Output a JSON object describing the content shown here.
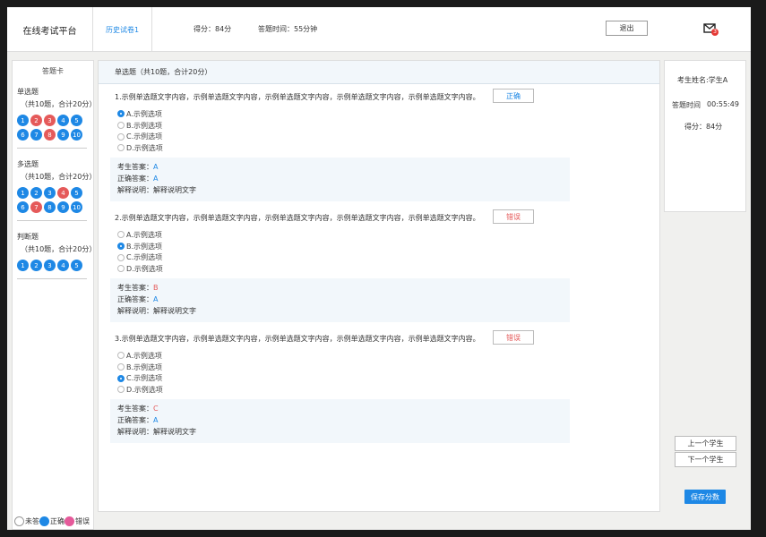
{
  "header": {
    "app_title": "在线考试平台",
    "history_tab": "历史试卷1",
    "score": "得分：84分",
    "answer_time": "答题时间：55分钟",
    "exit_label": "退出",
    "mail_badge": "3"
  },
  "sidebar": {
    "card_title": "答题卡",
    "sections": [
      {
        "title": "单选题",
        "subtitle": "（共10题，合计20分）",
        "items": [
          {
            "n": "1",
            "status": "correct"
          },
          {
            "n": "2",
            "status": "wrong"
          },
          {
            "n": "3",
            "status": "wrong"
          },
          {
            "n": "4",
            "status": "correct"
          },
          {
            "n": "5",
            "status": "correct"
          },
          {
            "n": "6",
            "status": "correct"
          },
          {
            "n": "7",
            "status": "correct"
          },
          {
            "n": "8",
            "status": "wrong"
          },
          {
            "n": "9",
            "status": "correct"
          },
          {
            "n": "10",
            "status": "correct"
          }
        ]
      },
      {
        "title": "多选题",
        "subtitle": "（共10题，合计20分）",
        "items": [
          {
            "n": "1",
            "status": "correct"
          },
          {
            "n": "2",
            "status": "correct"
          },
          {
            "n": "3",
            "status": "correct"
          },
          {
            "n": "4",
            "status": "wrong"
          },
          {
            "n": "5",
            "status": "correct"
          },
          {
            "n": "6",
            "status": "correct"
          },
          {
            "n": "7",
            "status": "wrong"
          },
          {
            "n": "8",
            "status": "correct"
          },
          {
            "n": "9",
            "status": "correct"
          },
          {
            "n": "10",
            "status": "correct"
          }
        ]
      },
      {
        "title": "判断题",
        "subtitle": "（共10题，合计20分）",
        "items": [
          {
            "n": "1",
            "status": "correct"
          },
          {
            "n": "2",
            "status": "correct"
          },
          {
            "n": "3",
            "status": "correct"
          },
          {
            "n": "4",
            "status": "correct"
          },
          {
            "n": "5",
            "status": "correct"
          }
        ]
      }
    ],
    "legend": {
      "unanswered": "未答",
      "correct": "正确",
      "wrong": "错误"
    }
  },
  "main": {
    "section_header": "单选题（共10题，合计20分）",
    "questions": [
      {
        "text": "1.示例单选题文字内容，示例单选题文字内容，示例单选题文字内容，示例单选题文字内容，示例单选题文字内容。",
        "result": "正确",
        "result_type": "ok",
        "options": [
          "A.示例选项",
          "B.示例选项",
          "C.示例选项",
          "D.示例选项"
        ],
        "selected": 0,
        "student_label": "考生答案：",
        "student_answer": "A",
        "correct_label": "正确答案：",
        "correct_answer": "A",
        "explain": "解释说明：解释说明文字"
      },
      {
        "text": "2.示例单选题文字内容，示例单选题文字内容，示例单选题文字内容，示例单选题文字内容，示例单选题文字内容。",
        "result": "错误",
        "result_type": "bad",
        "options": [
          "A.示例选项",
          "B.示例选项",
          "C.示例选项",
          "D.示例选项"
        ],
        "selected": 1,
        "student_label": "考生答案：",
        "student_answer": "B",
        "correct_label": "正确答案：",
        "correct_answer": "A",
        "explain": "解释说明：解释说明文字"
      },
      {
        "text": "3.示例单选题文字内容，示例单选题文字内容，示例单选题文字内容，示例单选题文字内容，示例单选题文字内容。",
        "result": "错误",
        "result_type": "bad",
        "options": [
          "A.示例选项",
          "B.示例选项",
          "C.示例选项",
          "D.示例选项"
        ],
        "selected": 2,
        "student_label": "考生答案：",
        "student_answer": "C",
        "correct_label": "正确答案：",
        "correct_answer": "A",
        "explain": "解释说明：解释说明文字"
      }
    ]
  },
  "right_panel": {
    "student_name": "考生姓名:学生A",
    "time_label": "答题时间",
    "time_value": "00:55:49",
    "score": "得分：84分",
    "prev_student": "上一个学生",
    "next_student": "下一个学生",
    "save_score": "保存分数"
  },
  "colors": {
    "accent": "#1e88e5",
    "wrong": "#e55a5a",
    "panel_bg": "#f2f7fb"
  }
}
